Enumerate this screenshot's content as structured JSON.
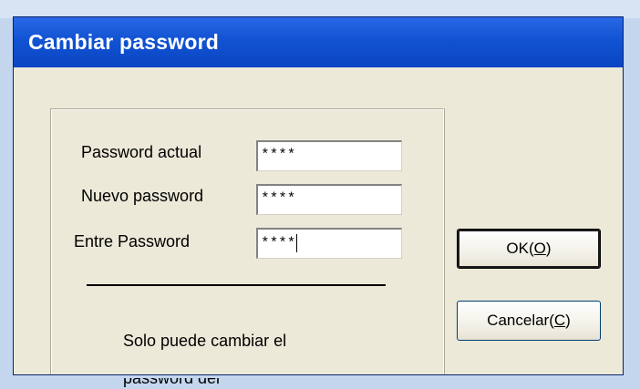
{
  "dialog": {
    "title": "Cambiar password"
  },
  "form": {
    "current_label": "Password actual",
    "current_value": "****",
    "new_label": "Nuevo password",
    "new_value": "****",
    "confirm_label": "Entre Password",
    "confirm_value": "****"
  },
  "buttons": {
    "ok_prefix": "OK(",
    "ok_accel": "O",
    "ok_suffix": ")",
    "cancel_prefix": "Cancelar(",
    "cancel_accel": "C",
    "cancel_suffix": ")"
  },
  "note": {
    "text": "Solo puede cambiar el",
    "cut_text": "password del"
  }
}
